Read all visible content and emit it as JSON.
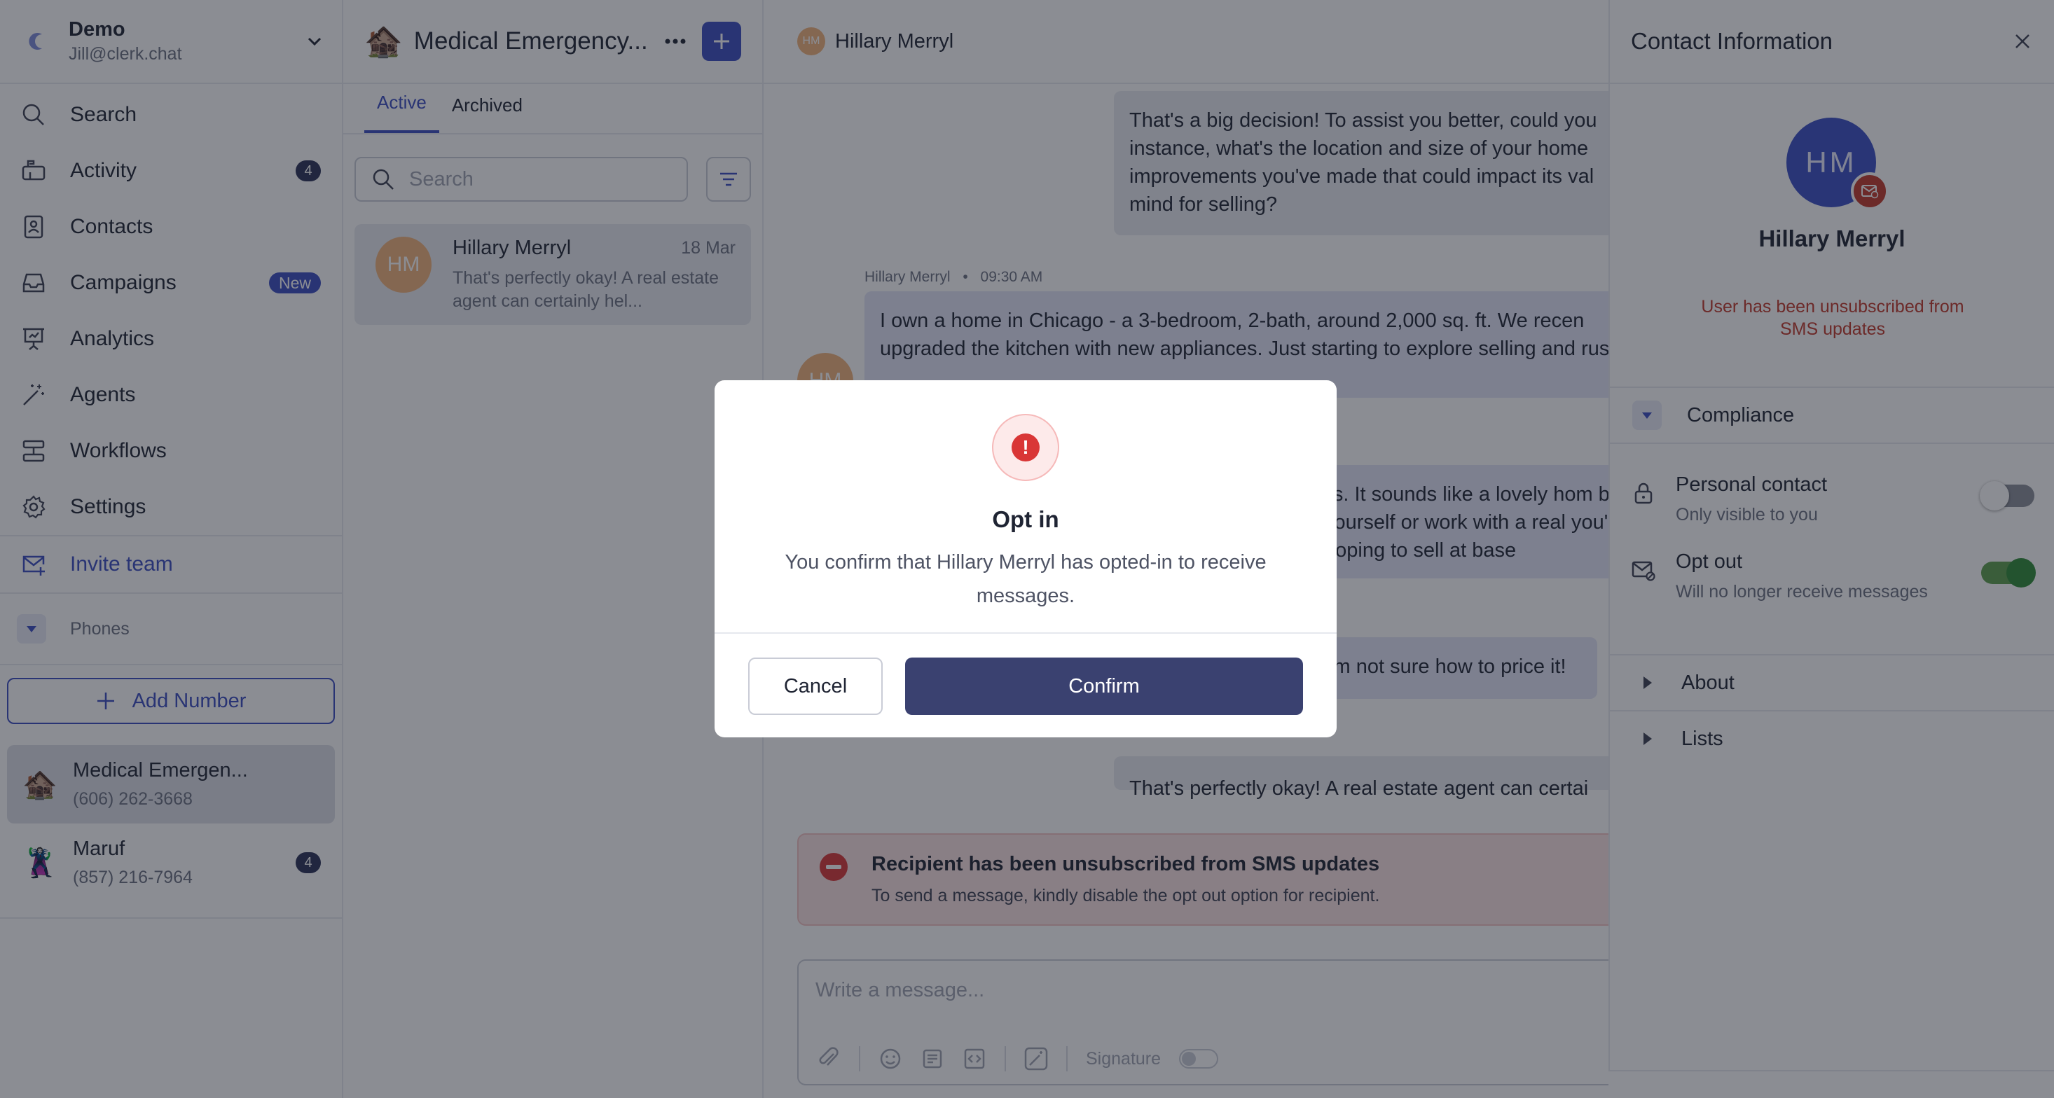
{
  "account": {
    "name": "Demo",
    "email": "Jill@clerk.chat"
  },
  "nav": {
    "search": "Search",
    "activity": "Activity",
    "activity_count": "4",
    "contacts": "Contacts",
    "campaigns": "Campaigns",
    "campaigns_badge": "New",
    "analytics": "Analytics",
    "agents": "Agents",
    "workflows": "Workflows",
    "settings": "Settings",
    "invite": "Invite team"
  },
  "phones": {
    "header": "Phones",
    "add_label": "Add Number",
    "items": [
      {
        "emoji": "🏚️",
        "name": "Medical Emergen...",
        "number": "(606) 262-3668"
      },
      {
        "emoji": "🦹",
        "name": "Maruf",
        "number": "(857) 216-7964",
        "count": "4"
      }
    ]
  },
  "conversations": {
    "emoji": "🏚️",
    "title": "Medical Emergency...",
    "tabs": [
      "Active",
      "Archived"
    ],
    "search_placeholder": "Search",
    "items": [
      {
        "initials": "HM",
        "name": "Hillary Merryl",
        "date": "18 Mar",
        "snippet": "That's perfectly okay! A real estate agent can certainly hel..."
      }
    ]
  },
  "chat": {
    "contact_initials": "HM",
    "contact_name": "Hillary Merryl",
    "messages": [
      {
        "text": "That's a big decision! To assist you better, could you instance, what's the location and size of your home improvements you've made that could impact its val mind for selling?"
      },
      {
        "sender": "Hillary Merryl",
        "time": "09:30 AM",
        "text": "I own a home in Chicago - a 3-bedroom, 2-bath, around 2,000 sq. ft. We recen upgraded the kitchen with new appliances. Just starting to explore selling and rush."
      },
      {
        "text": "ils. It sounds like a lovely hom by yourself or work with a real you're hoping to sell at base"
      },
      {
        "text": "'m not sure how to price it!"
      },
      {
        "text": "That's perfectly okay! A real estate agent can certai"
      }
    ],
    "banner_title": "Recipient has been unsubscribed from SMS updates",
    "banner_sub": "To send a message, kindly disable the opt out option for recipient.",
    "composer_placeholder": "Write a message...",
    "signature_label": "Signature"
  },
  "panel": {
    "title": "Contact Information",
    "initials": "HM",
    "name": "Hillary Merryl",
    "warning": "User has been unsubscribed from SMS updates",
    "compliance": "Compliance",
    "personal_title": "Personal contact",
    "personal_sub": "Only visible to you",
    "personal_on": false,
    "optout_title": "Opt out",
    "optout_sub": "Will no longer receive messages",
    "optout_on": true,
    "about": "About",
    "lists": "Lists"
  },
  "modal": {
    "icon": "!",
    "title": "Opt in",
    "body": "You confirm that Hillary Merryl has opted-in to receive messages.",
    "cancel": "Cancel",
    "confirm": "Confirm"
  },
  "colors": {
    "accent": "#3b4cc0",
    "confirm": "#3a4170",
    "danger": "#d93636",
    "toggle_on": "#2e8b36"
  }
}
